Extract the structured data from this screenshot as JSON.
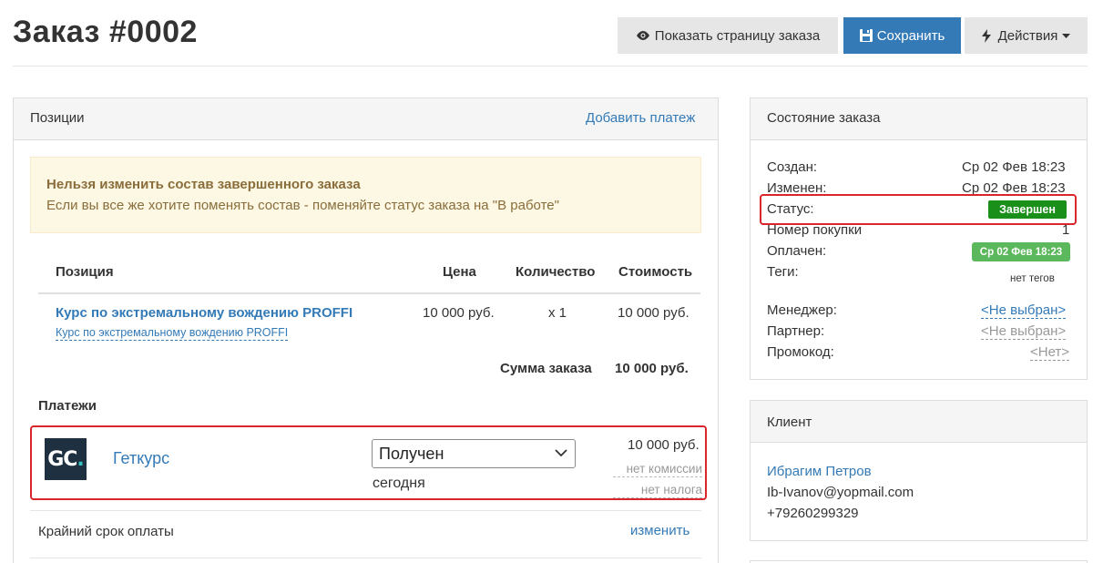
{
  "header": {
    "title": "Заказ #0002",
    "show_page_label": "Показать страницу заказа",
    "save_label": "Сохранить",
    "actions_label": "Действия"
  },
  "positions": {
    "title": "Позиции",
    "add_payment": "Добавить платеж",
    "warning_title": "Нельзя изменить состав завершенного заказа",
    "warning_text": "Если вы все же хотите поменять состав - поменяйте статус заказа на \"В работе\"",
    "columns": [
      "Позиция",
      "Цена",
      "Количество",
      "Стоимость"
    ],
    "items": [
      {
        "title": "Курс по экстремальному вождению PROFFI",
        "subtitle": "Курс по экстремальному вождению PROFFI",
        "price": "10 000 руб.",
        "quantity": "x 1",
        "cost": "10 000 руб."
      }
    ],
    "total_label": "Сумма заказа",
    "total_value": "10 000 руб."
  },
  "payments": {
    "title": "Платежи",
    "items": [
      {
        "logo_text": "GC",
        "logo_dot": ".",
        "provider": "Геткурс",
        "status": "Получен",
        "date": "сегодня",
        "amount": "10 000 руб.",
        "commission": "нет комиссии",
        "tax": "нет налога"
      }
    ],
    "deadline_label": "Крайний срок оплаты",
    "deadline_change": "изменить"
  },
  "order_state": {
    "title": "Состояние заказа",
    "created_label": "Создан:",
    "created_value": "Ср 02 Фев 18:23",
    "changed_label": "Изменен:",
    "changed_value": "Ср 02 Фев 18:23",
    "status_label": "Статус:",
    "status_value": "Завершен",
    "purchase_label": "Номер покупки",
    "purchase_value": "1",
    "paid_label": "Оплачен:",
    "paid_value": "Ср 02 Фев 18:23",
    "tags_label": "Теги:",
    "tags_value": "нет тегов",
    "manager_label": "Менеджер:",
    "manager_value": "<Не выбран>",
    "partner_label": "Партнер:",
    "partner_value": "<Не выбран>",
    "promo_label": "Промокод:",
    "promo_value": "<Нет>"
  },
  "client": {
    "title": "Клиент",
    "name": "Ибрагим Петров",
    "email": "Ib-Ivanov@yopmail.com",
    "phone": "+79260299329"
  },
  "colors": {
    "primary": "#337ab7",
    "status_done": "#1a8f1a",
    "paid_badge": "#5cb85c",
    "highlight": "#d9262c",
    "warning_bg": "#fcf8e3",
    "warning_text": "#8a6d3b"
  },
  "icons": {
    "show_page": "eye-icon",
    "save": "floppy-disk-icon",
    "actions": "lightning-icon",
    "dropdown": "caret-down-icon",
    "select_arrow": "chevron-down-icon"
  }
}
